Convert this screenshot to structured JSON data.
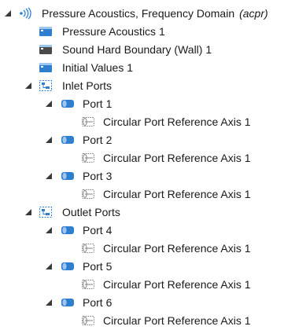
{
  "tree": {
    "root": {
      "label": "Pressure Acoustics, Frequency Domain",
      "tag": "(acpr)"
    },
    "physics_nodes": [
      {
        "label": "Pressure Acoustics 1"
      },
      {
        "label": "Sound Hard Boundary (Wall) 1"
      },
      {
        "label": "Initial Values 1"
      }
    ],
    "groups": [
      {
        "label": "Inlet Ports",
        "ports": [
          {
            "label": "Port 1",
            "child": "Circular Port Reference Axis 1"
          },
          {
            "label": "Port 2",
            "child": "Circular Port Reference Axis 1"
          },
          {
            "label": "Port 3",
            "child": "Circular Port Reference Axis 1"
          }
        ]
      },
      {
        "label": "Outlet Ports",
        "ports": [
          {
            "label": "Port 4",
            "child": "Circular Port Reference Axis 1"
          },
          {
            "label": "Port 5",
            "child": "Circular Port Reference Axis 1"
          },
          {
            "label": "Port 6",
            "child": "Circular Port Reference Axis 1"
          }
        ]
      }
    ]
  },
  "colors": {
    "icon_blue": "#2f7fd0",
    "icon_light": "#9fc6ee",
    "arrow": "#3a3a3a",
    "text": "#1a1a1a"
  }
}
